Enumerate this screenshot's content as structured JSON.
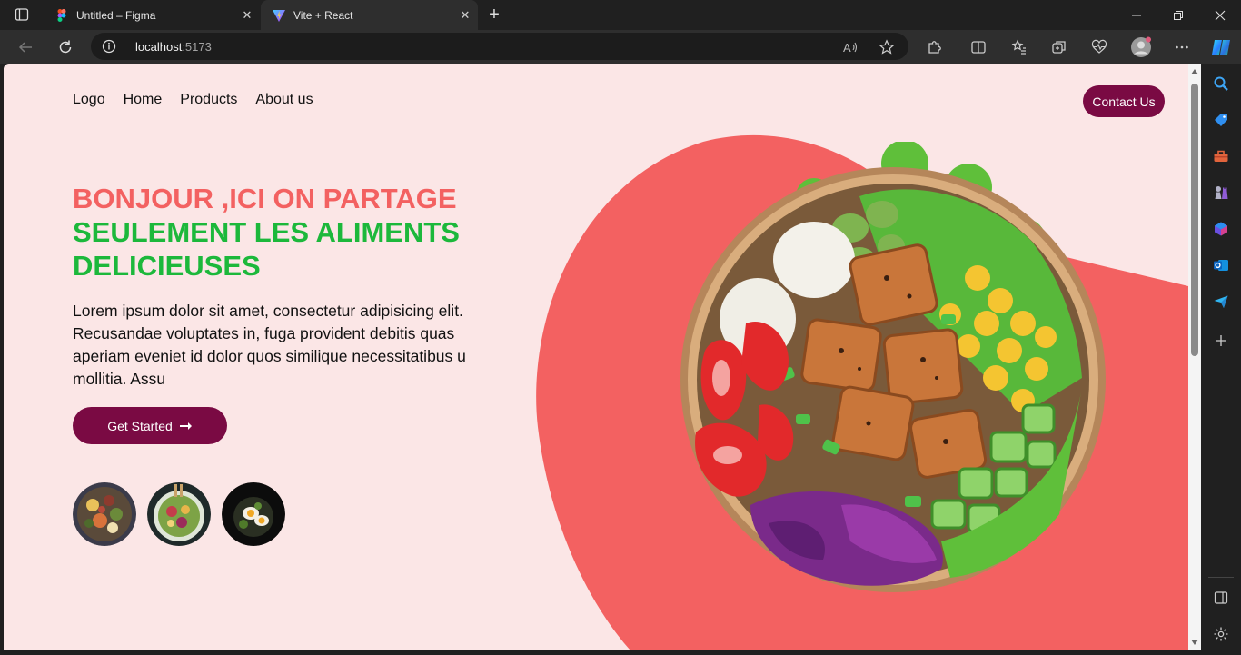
{
  "browser": {
    "tabs": [
      {
        "title": "Untitled – Figma",
        "favicon": "figma-icon"
      },
      {
        "title": "Vite + React",
        "favicon": "vite-icon"
      }
    ],
    "url_host": "localhost",
    "url_port": ":5173"
  },
  "nav": {
    "logo": "Logo",
    "items": [
      "Home",
      "Products",
      "About us"
    ],
    "contact": "Contact Us"
  },
  "hero": {
    "headline_red": "BONJOUR ,ICI ON PARTAGE",
    "headline_green_1": "SEULEMENT LES ALIMENTS",
    "headline_green_2": "DELICIEUSES",
    "lead": "Lorem ipsum dolor sit amet, consectetur adipisicing elit. Recusandae voluptates in, fuga provident debitis quas aperiam eveniet id dolor quos similique necessitatibus u mollitia. Assu",
    "cta": "Get Started",
    "cta_icon": "arrow-right-icon"
  },
  "colors": {
    "page_bg": "#fbe6e6",
    "accent_red": "#f36161",
    "accent_green": "#1cb83b",
    "button": "#7a0a43"
  }
}
